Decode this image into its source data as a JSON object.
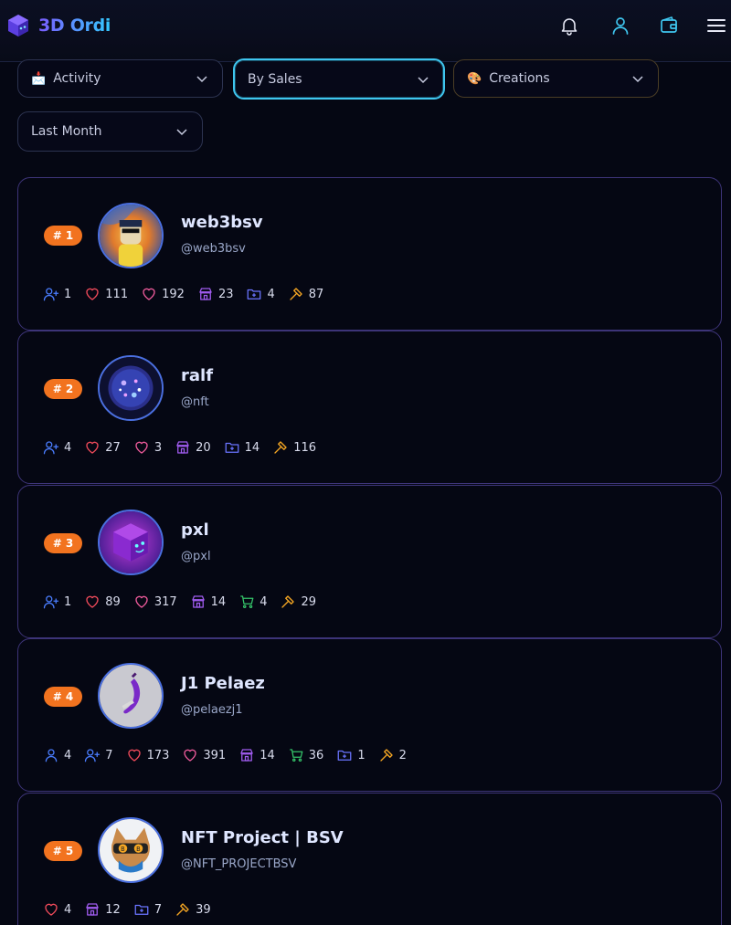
{
  "header": {
    "title": "3D Ordi"
  },
  "filters": {
    "activity": {
      "label": "Activity",
      "emoji": "📩"
    },
    "sort": {
      "label": "By Sales"
    },
    "category": {
      "label": "Creations",
      "emoji": "🎨"
    },
    "period": {
      "label": "Last Month"
    }
  },
  "creators": [
    {
      "rank": "# 1",
      "name": "web3bsv",
      "handle": "@web3bsv",
      "stats": [
        {
          "icon": "user-plus-icon",
          "value": "1"
        },
        {
          "icon": "heart-icon",
          "value": "111"
        },
        {
          "icon": "heart-outline-icon",
          "value": "192"
        },
        {
          "icon": "store-icon",
          "value": "23"
        },
        {
          "icon": "folder-plus-icon",
          "value": "4"
        },
        {
          "icon": "hammer-icon",
          "value": "87"
        }
      ]
    },
    {
      "rank": "# 2",
      "name": "ralf",
      "handle": "@nft",
      "stats": [
        {
          "icon": "user-plus-icon",
          "value": "4"
        },
        {
          "icon": "heart-icon",
          "value": "27"
        },
        {
          "icon": "heart-outline-icon",
          "value": "3"
        },
        {
          "icon": "store-icon",
          "value": "20"
        },
        {
          "icon": "folder-plus-icon",
          "value": "14"
        },
        {
          "icon": "hammer-icon",
          "value": "116"
        }
      ]
    },
    {
      "rank": "# 3",
      "name": "pxl",
      "handle": "@pxl",
      "stats": [
        {
          "icon": "user-plus-icon",
          "value": "1"
        },
        {
          "icon": "heart-icon",
          "value": "89"
        },
        {
          "icon": "heart-outline-icon",
          "value": "317"
        },
        {
          "icon": "store-icon",
          "value": "14"
        },
        {
          "icon": "cart-icon",
          "value": "4"
        },
        {
          "icon": "hammer-icon",
          "value": "29"
        }
      ]
    },
    {
      "rank": "# 4",
      "name": "J1 Pelaez",
      "handle": "@pelaezj1",
      "stats": [
        {
          "icon": "user-icon",
          "value": "4"
        },
        {
          "icon": "user-plus-icon",
          "value": "7"
        },
        {
          "icon": "heart-icon",
          "value": "173"
        },
        {
          "icon": "heart-outline-icon",
          "value": "391"
        },
        {
          "icon": "store-icon",
          "value": "14"
        },
        {
          "icon": "cart-icon",
          "value": "36"
        },
        {
          "icon": "folder-plus-icon",
          "value": "1"
        },
        {
          "icon": "hammer-icon",
          "value": "2"
        }
      ]
    },
    {
      "rank": "# 5",
      "name": "NFT Project | BSV",
      "handle": "@NFT_PROJECTBSV",
      "stats": [
        {
          "icon": "heart-icon",
          "value": "4"
        },
        {
          "icon": "store-icon",
          "value": "12"
        },
        {
          "icon": "folder-plus-icon",
          "value": "7"
        },
        {
          "icon": "hammer-icon",
          "value": "39"
        }
      ]
    }
  ],
  "colors": {
    "accent": "#3fc6ef",
    "rank_badge": "#f2731f",
    "card_border": "#3d3478",
    "heart": "#ef4a5a",
    "heart_outline": "#ec5a9a",
    "store": "#a15cf0",
    "folder": "#6a74ff",
    "cart": "#35c46a",
    "hammer": "#f5a623",
    "user": "#4a7dff"
  }
}
